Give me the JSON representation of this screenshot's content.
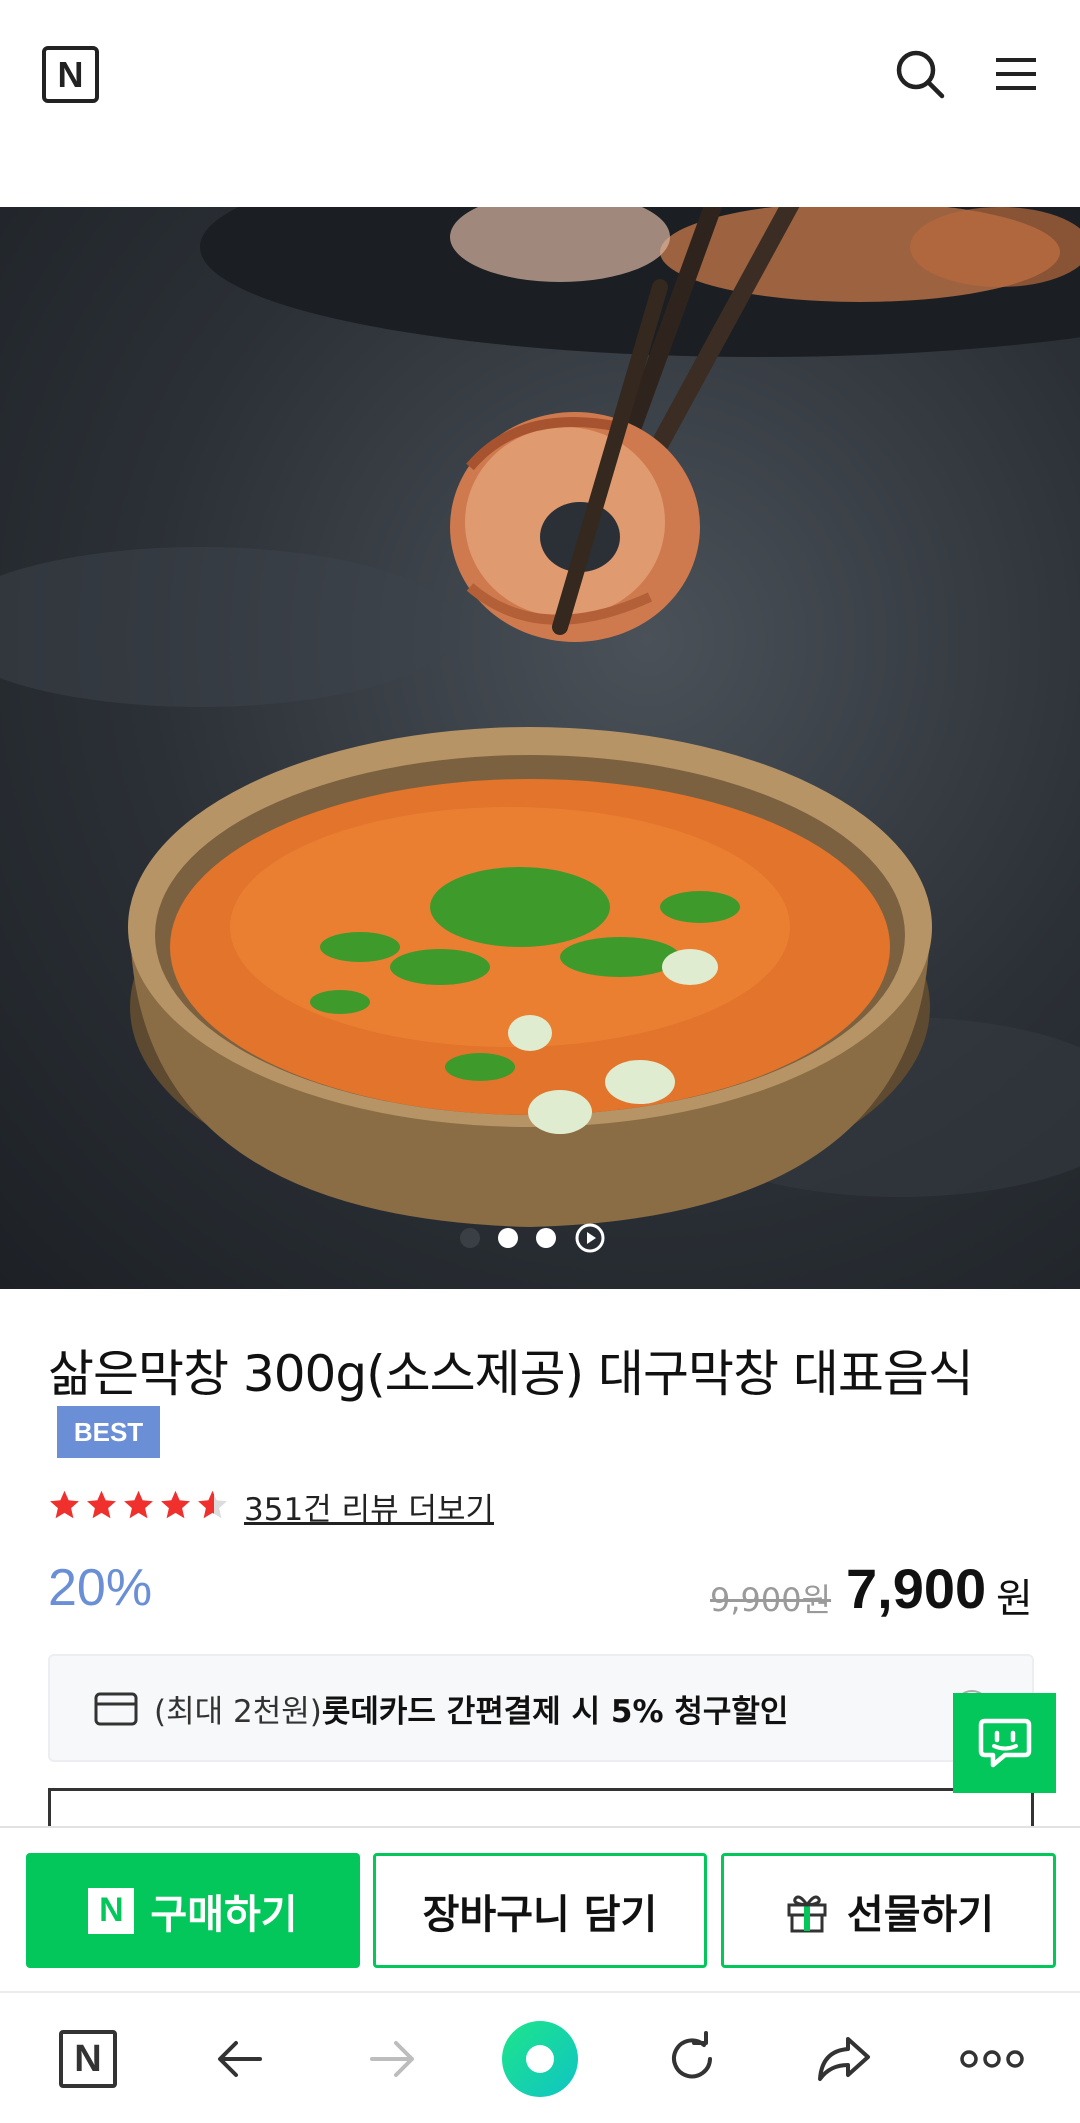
{
  "header": {
    "logo": "N",
    "search_icon": "search-icon",
    "menu_icon": "hamburger-menu-icon"
  },
  "gallery": {
    "slide_count": 3,
    "active_index": 0,
    "play_icon": "play-circle-icon"
  },
  "product": {
    "title": "삶은막창 300g(소스제공) 대구막창 대표음식",
    "badge": "BEST",
    "rating": 4.5,
    "review_link": "351건 리뷰 더보기",
    "discount": "20%",
    "original_price": "9,900원",
    "sale_price": "7,900",
    "currency": "원"
  },
  "promo": {
    "prefix": "(최대 2천원)",
    "highlight": "롯데카드 간편결제 시 5% 청구할인",
    "card_icon": "credit-card-icon"
  },
  "chat": {
    "icon": "chat-bubble-icon"
  },
  "actions": {
    "buy_logo": "N",
    "buy_label": "구매하기",
    "cart_label": "장바구니 담기",
    "gift_label": "선물하기"
  },
  "browser": {
    "logo": "N",
    "icons": [
      "back-arrow-icon",
      "forward-arrow-icon",
      "green-dot-icon",
      "reload-icon",
      "share-icon",
      "more-icon"
    ]
  },
  "colors": {
    "brand_green": "#03c75a",
    "discount_blue": "#6b8fd6",
    "star_red": "#f0302d"
  }
}
